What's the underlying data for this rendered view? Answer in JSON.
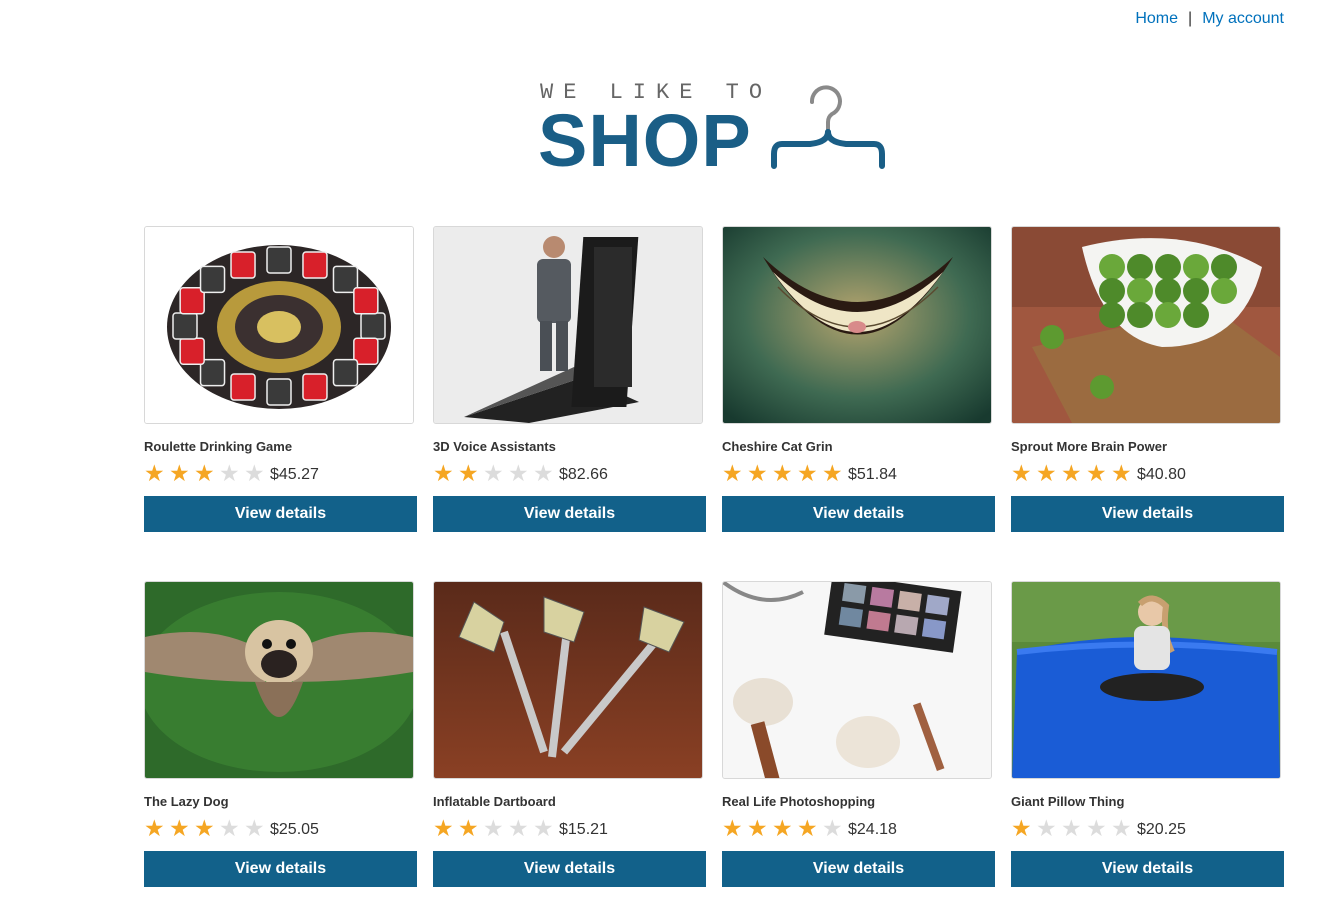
{
  "nav": {
    "home": "Home",
    "separator": "|",
    "account": "My account"
  },
  "logo": {
    "tagline": "WE LIKE TO",
    "wordmark": "SHOP",
    "accent": "#1a5e86"
  },
  "button_label": "View details",
  "colors": {
    "button": "#12618a",
    "star_on": "#f5a623",
    "star_off": "#dcdcdc",
    "link": "#0071bc"
  },
  "products": [
    {
      "name": "Roulette Drinking Game",
      "rating": 3,
      "price": "$45.27",
      "image": "roulette-image"
    },
    {
      "name": "3D Voice Assistants",
      "rating": 2,
      "price": "$82.66",
      "image": "phone-figure-image"
    },
    {
      "name": "Cheshire Cat Grin",
      "rating": 5,
      "price": "$51.84",
      "image": "grin-image"
    },
    {
      "name": "Sprout More Brain Power",
      "rating": 5,
      "price": "$40.80",
      "image": "sprouts-image"
    },
    {
      "name": "The Lazy Dog",
      "rating": 3,
      "price": "$25.05",
      "image": "flying-pug-image"
    },
    {
      "name": "Inflatable Dartboard",
      "rating": 2,
      "price": "$15.21",
      "image": "darts-image"
    },
    {
      "name": "Real Life Photoshopping",
      "rating": 4,
      "price": "$24.18",
      "image": "makeup-image"
    },
    {
      "name": "Giant Pillow Thing",
      "rating": 1,
      "price": "$20.25",
      "image": "pillow-image"
    }
  ]
}
